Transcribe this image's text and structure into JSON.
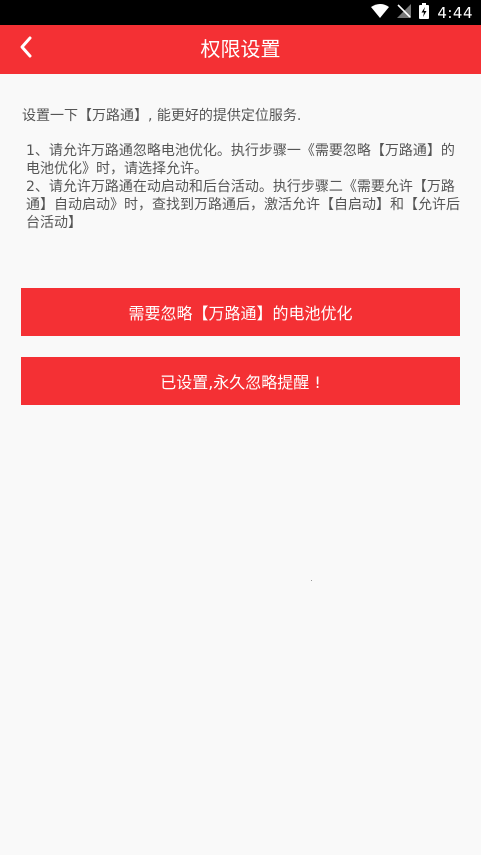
{
  "status_bar": {
    "time": "4:44",
    "icons": [
      "wifi-icon",
      "no-signal-icon",
      "battery-charging-icon"
    ]
  },
  "header": {
    "back_icon": "chevron-left-icon",
    "title": "权限设置"
  },
  "main": {
    "intro": "设置一下【万路通】, 能更好的提供定位服务.",
    "steps": [
      "1、请允许万路通忽略电池优化。执行步骤一《需要忽略【万路通】的电池优化》时，请选择允许。",
      "2、请允许万路通在动启动和后台活动。执行步骤二《需要允许【万路通】自动启动》时，查找到万路通后，激活允许【自启动】和【允许后台活动】"
    ],
    "buttons": {
      "ignore_battery": "需要忽略【万路通】的电池优化",
      "already_set": "已设置,永久忽略提醒 !"
    }
  },
  "colors": {
    "accent": "#f43034",
    "background": "#f9f9f9",
    "text": "#555555"
  }
}
